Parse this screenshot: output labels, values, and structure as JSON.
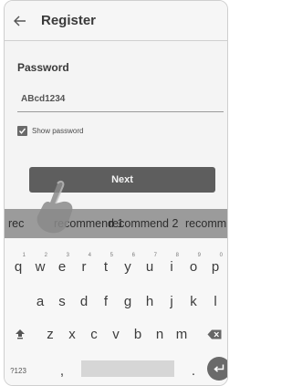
{
  "app_bar": {
    "title": "Register",
    "back_icon": "back-arrow-icon"
  },
  "form": {
    "password_label": "Password",
    "password_value": "ABcd1234",
    "show_password_label": "Show password",
    "show_password_checked": true,
    "next_label": "Next"
  },
  "suggestions": [
    "recommend 1",
    "recommend 2",
    "recomm"
  ],
  "suggestion_prefix": "rec",
  "keyboard": {
    "row1": [
      {
        "key": "q",
        "hint": "1"
      },
      {
        "key": "w",
        "hint": "2"
      },
      {
        "key": "e",
        "hint": "3"
      },
      {
        "key": "r",
        "hint": "4"
      },
      {
        "key": "t",
        "hint": "5"
      },
      {
        "key": "y",
        "hint": "6"
      },
      {
        "key": "u",
        "hint": "7"
      },
      {
        "key": "i",
        "hint": "8"
      },
      {
        "key": "o",
        "hint": "9"
      },
      {
        "key": "p",
        "hint": "0"
      }
    ],
    "row2": [
      "a",
      "s",
      "d",
      "f",
      "g",
      "h",
      "j",
      "k",
      "l"
    ],
    "row3": [
      "z",
      "x",
      "c",
      "v",
      "b",
      "n",
      "m"
    ],
    "symbols_label": "?123",
    "comma": ",",
    "period": "."
  },
  "colors": {
    "button": "#5e5e5e",
    "suggest_bar": "#9b9b9b",
    "checkbox": "#6a6a6a"
  }
}
